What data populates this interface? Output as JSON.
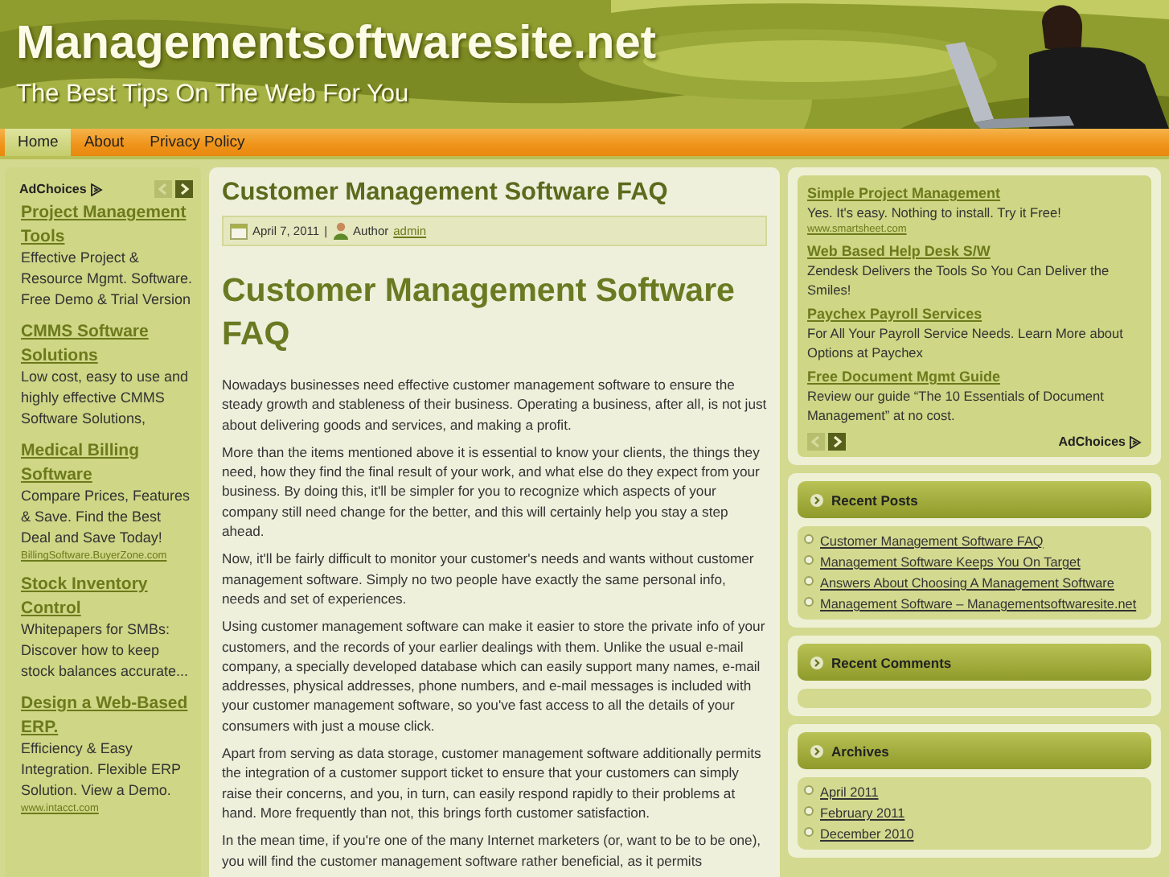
{
  "header": {
    "title": "Managementsoftwaresite.net",
    "tagline": "The Best Tips On The Web For You"
  },
  "nav": [
    {
      "label": "Home",
      "selected": true
    },
    {
      "label": "About",
      "selected": false
    },
    {
      "label": "Privacy Policy",
      "selected": false
    }
  ],
  "left_ads": {
    "label": "AdChoices",
    "prev": {
      "disabled": true
    },
    "next": {
      "disabled": false
    },
    "ads": [
      {
        "title": "Project Management Tools",
        "text": "Effective Project & Resource Mgmt. Software. Free Demo & Trial Version"
      },
      {
        "title": "CMMS Software Solutions",
        "text": "Low cost, easy to use and highly effective CMMS Software Solutions,"
      },
      {
        "title": "Medical Billing Software",
        "text": "Compare Prices, Features & Save. Find the Best Deal and Save Today!",
        "url": "BillingSoftware.BuyerZone.com"
      },
      {
        "title": "Stock Inventory Control",
        "text": "Whitepapers for SMBs: Discover how to keep stock balances accurate..."
      },
      {
        "title": "Design a Web-Based ERP.",
        "text": "Efficiency & Easy Integration. Flexible ERP Solution. View a Demo.",
        "url": "www.intacct.com"
      }
    ]
  },
  "post": {
    "title": "Customer Management Software FAQ",
    "date": "April 7, 2011",
    "separator": "|",
    "author_label": "Author",
    "author": "admin",
    "heading": "Customer Management Software FAQ",
    "paragraphs": [
      "Nowadays businesses need effective customer management software to ensure the steady growth and stableness of their business. Operating a business, after all, is not just about delivering goods and services, and making a profit.",
      "More than the items mentioned above it is essential to know your clients, the things they need, how they find the final result of your work, and what else do they expect from your business. By doing this, it'll be simpler for you to recognize which aspects of your company still need change for the better, and this will certainly help you stay a step ahead.",
      "Now, it'll be fairly difficult to monitor your customer's needs and wants without customer management software. Simply no two people have exactly the same personal info, needs and set of experiences.",
      "Using customer management software can make it easier to store the private info of your customers, and the records of your earlier dealings with them. Unlike the usual e-mail company, a specially developed database which can easily support many names, e-mail addresses, physical addresses, phone numbers, and e-mail messages is included with your customer management software, so you've fast access to all the details of your consumers with just a mouse click.",
      "Apart from serving as data storage, customer management software additionally permits the integration of a customer support ticket to ensure that your customers can simply raise their concerns, and you, in turn, can easily respond rapidly to their problems at hand. More frequently than not, this brings forth customer satisfaction.",
      "In the mean time, if you're one of the many Internet marketers (or, want to be to be one), you will find the customer management software rather beneficial, as it permits"
    ]
  },
  "right_ads": {
    "label": "AdChoices",
    "prev": {
      "disabled": true
    },
    "next": {
      "disabled": false
    },
    "ads": [
      {
        "title": "Simple Project Management",
        "text": "Yes. It's easy. Nothing to install. Try it Free!",
        "url": "www.smartsheet.com"
      },
      {
        "title": "Web Based Help Desk S/W",
        "text": "Zendesk Delivers the Tools So You Can Deliver the Smiles!"
      },
      {
        "title": "Paychex Payroll Services",
        "text": "For All Your Payroll Service Needs. Learn More about Options at Paychex"
      },
      {
        "title": "Free Document Mgmt Guide",
        "text": "Review our guide “The 10 Essentials of Document Management” at no cost."
      }
    ]
  },
  "widgets": [
    {
      "title": "Recent Posts",
      "items": [
        "Customer Management Software FAQ",
        "Management Software Keeps You On Target",
        "Answers About Choosing A Management Software",
        "Management Software – Managementsoftwaresite.net"
      ]
    },
    {
      "title": "Recent Comments"
    },
    {
      "title": "Archives",
      "items": [
        "April 2011",
        "February 2011",
        "December 2010"
      ]
    }
  ]
}
